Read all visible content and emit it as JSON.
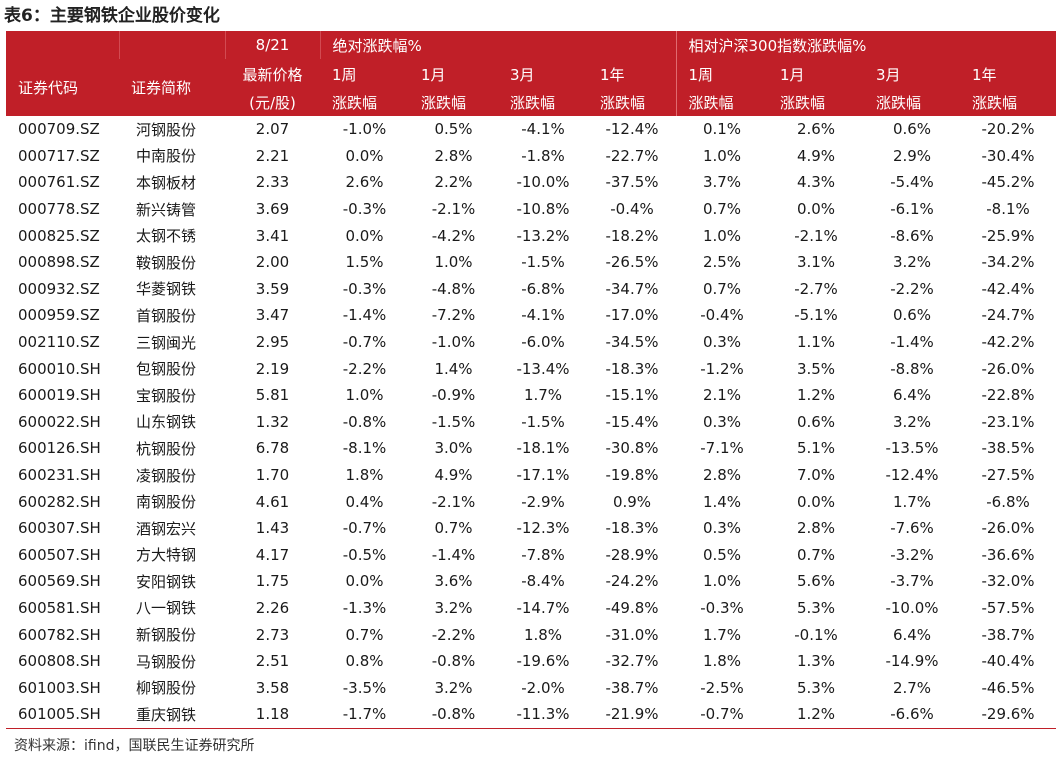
{
  "title": "表6：主要钢铁企业股价变化",
  "header": {
    "row1": {
      "date": "8/21",
      "abs_group": "绝对涨跌幅%",
      "rel_group": "相对沪深300指数涨跌幅%"
    },
    "row2": {
      "code": "证券代码",
      "name": "证券简称",
      "price": "最新价格",
      "w1": "1周",
      "m1": "1月",
      "m3": "3月",
      "y1": "1年"
    },
    "row3": {
      "price_unit": "(元/股)",
      "chg": "涨跌幅"
    }
  },
  "rows": [
    [
      "000709.SZ",
      "河钢股份",
      "2.07",
      "-1.0%",
      "0.5%",
      "-4.1%",
      "-12.4%",
      "0.1%",
      "2.6%",
      "0.6%",
      "-20.2%"
    ],
    [
      "000717.SZ",
      "中南股份",
      "2.21",
      "0.0%",
      "2.8%",
      "-1.8%",
      "-22.7%",
      "1.0%",
      "4.9%",
      "2.9%",
      "-30.4%"
    ],
    [
      "000761.SZ",
      "本钢板材",
      "2.33",
      "2.6%",
      "2.2%",
      "-10.0%",
      "-37.5%",
      "3.7%",
      "4.3%",
      "-5.4%",
      "-45.2%"
    ],
    [
      "000778.SZ",
      "新兴铸管",
      "3.69",
      "-0.3%",
      "-2.1%",
      "-10.8%",
      "-0.4%",
      "0.7%",
      "0.0%",
      "-6.1%",
      "-8.1%"
    ],
    [
      "000825.SZ",
      "太钢不锈",
      "3.41",
      "0.0%",
      "-4.2%",
      "-13.2%",
      "-18.2%",
      "1.0%",
      "-2.1%",
      "-8.6%",
      "-25.9%"
    ],
    [
      "000898.SZ",
      "鞍钢股份",
      "2.00",
      "1.5%",
      "1.0%",
      "-1.5%",
      "-26.5%",
      "2.5%",
      "3.1%",
      "3.2%",
      "-34.2%"
    ],
    [
      "000932.SZ",
      "华菱钢铁",
      "3.59",
      "-0.3%",
      "-4.8%",
      "-6.8%",
      "-34.7%",
      "0.7%",
      "-2.7%",
      "-2.2%",
      "-42.4%"
    ],
    [
      "000959.SZ",
      "首钢股份",
      "3.47",
      "-1.4%",
      "-7.2%",
      "-4.1%",
      "-17.0%",
      "-0.4%",
      "-5.1%",
      "0.6%",
      "-24.7%"
    ],
    [
      "002110.SZ",
      "三钢闽光",
      "2.95",
      "-0.7%",
      "-1.0%",
      "-6.0%",
      "-34.5%",
      "0.3%",
      "1.1%",
      "-1.4%",
      "-42.2%"
    ],
    [
      "600010.SH",
      "包钢股份",
      "2.19",
      "-2.2%",
      "1.4%",
      "-13.4%",
      "-18.3%",
      "-1.2%",
      "3.5%",
      "-8.8%",
      "-26.0%"
    ],
    [
      "600019.SH",
      "宝钢股份",
      "5.81",
      "1.0%",
      "-0.9%",
      "1.7%",
      "-15.1%",
      "2.1%",
      "1.2%",
      "6.4%",
      "-22.8%"
    ],
    [
      "600022.SH",
      "山东钢铁",
      "1.32",
      "-0.8%",
      "-1.5%",
      "-1.5%",
      "-15.4%",
      "0.3%",
      "0.6%",
      "3.2%",
      "-23.1%"
    ],
    [
      "600126.SH",
      "杭钢股份",
      "6.78",
      "-8.1%",
      "3.0%",
      "-18.1%",
      "-30.8%",
      "-7.1%",
      "5.1%",
      "-13.5%",
      "-38.5%"
    ],
    [
      "600231.SH",
      "凌钢股份",
      "1.70",
      "1.8%",
      "4.9%",
      "-17.1%",
      "-19.8%",
      "2.8%",
      "7.0%",
      "-12.4%",
      "-27.5%"
    ],
    [
      "600282.SH",
      "南钢股份",
      "4.61",
      "0.4%",
      "-2.1%",
      "-2.9%",
      "0.9%",
      "1.4%",
      "0.0%",
      "1.7%",
      "-6.8%"
    ],
    [
      "600307.SH",
      "酒钢宏兴",
      "1.43",
      "-0.7%",
      "0.7%",
      "-12.3%",
      "-18.3%",
      "0.3%",
      "2.8%",
      "-7.6%",
      "-26.0%"
    ],
    [
      "600507.SH",
      "方大特钢",
      "4.17",
      "-0.5%",
      "-1.4%",
      "-7.8%",
      "-28.9%",
      "0.5%",
      "0.7%",
      "-3.2%",
      "-36.6%"
    ],
    [
      "600569.SH",
      "安阳钢铁",
      "1.75",
      "0.0%",
      "3.6%",
      "-8.4%",
      "-24.2%",
      "1.0%",
      "5.6%",
      "-3.7%",
      "-32.0%"
    ],
    [
      "600581.SH",
      "八一钢铁",
      "2.26",
      "-1.3%",
      "3.2%",
      "-14.7%",
      "-49.8%",
      "-0.3%",
      "5.3%",
      "-10.0%",
      "-57.5%"
    ],
    [
      "600782.SH",
      "新钢股份",
      "2.73",
      "0.7%",
      "-2.2%",
      "1.8%",
      "-31.0%",
      "1.7%",
      "-0.1%",
      "6.4%",
      "-38.7%"
    ],
    [
      "600808.SH",
      "马钢股份",
      "2.51",
      "0.8%",
      "-0.8%",
      "-19.6%",
      "-32.7%",
      "1.8%",
      "1.3%",
      "-14.9%",
      "-40.4%"
    ],
    [
      "601003.SH",
      "柳钢股份",
      "3.58",
      "-3.5%",
      "3.2%",
      "-2.0%",
      "-38.7%",
      "-2.5%",
      "5.3%",
      "2.7%",
      "-46.5%"
    ],
    [
      "601005.SH",
      "重庆钢铁",
      "1.18",
      "-1.7%",
      "-0.8%",
      "-11.3%",
      "-21.9%",
      "-0.7%",
      "1.2%",
      "-6.6%",
      "-29.6%"
    ]
  ],
  "footer": {
    "source": "资料来源：ifind，国联民生证券研究所"
  }
}
